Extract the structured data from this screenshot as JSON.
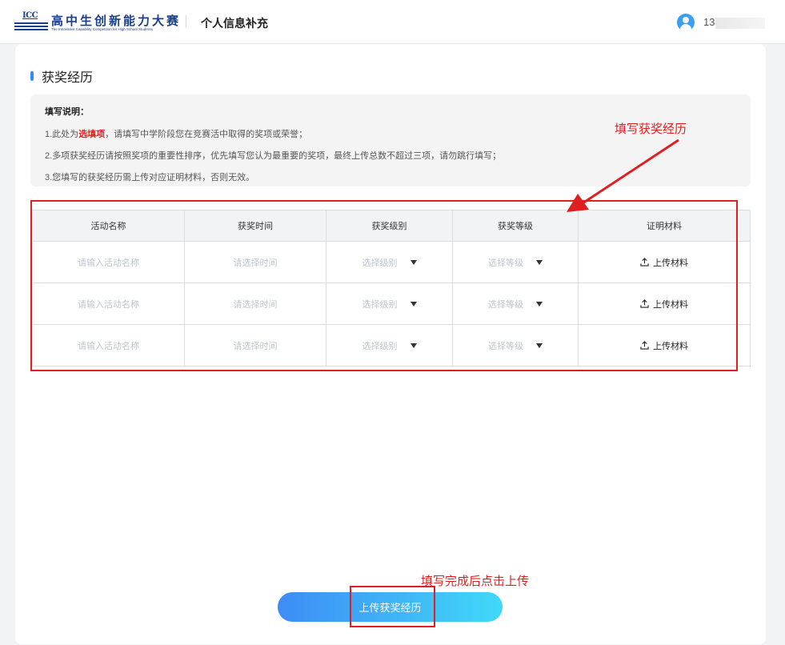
{
  "header": {
    "logo_short": "ICC",
    "logo_cn": "高中生创新能力大赛",
    "logo_en": "The Innovative Capability Competition for High School Students",
    "page_title": "个人信息补充",
    "phone_prefix": "13"
  },
  "section": {
    "title": "获奖经历"
  },
  "notice": {
    "title": "填写说明：",
    "line1_pre": "1.此处为",
    "line1_highlight": "选填项",
    "line1_post": "，请填写中学阶段您在竞赛活中取得的奖项或荣誉；",
    "line2": "2.多项获奖经历请按照奖项的重要性排序，优先填写您认为最重要的奖项，最终上传总数不超过三项，请勿跳行填写；",
    "line3": "3.您填写的获奖经历需上传对应证明材料，否则无效。"
  },
  "table": {
    "headers": [
      "活动名称",
      "获奖时间",
      "获奖级别",
      "获奖等级",
      "证明材料"
    ],
    "rows": [
      {
        "name_placeholder": "请输入活动名称",
        "time_placeholder": "请选择时间",
        "level_placeholder": "选择级别",
        "grade_placeholder": "选择等级",
        "upload_label": "上传材料"
      },
      {
        "name_placeholder": "请输入活动名称",
        "time_placeholder": "请选择时间",
        "level_placeholder": "选择级别",
        "grade_placeholder": "选择等级",
        "upload_label": "上传材料"
      },
      {
        "name_placeholder": "请输入活动名称",
        "time_placeholder": "请选择时间",
        "level_placeholder": "选择级别",
        "grade_placeholder": "选择等级",
        "upload_label": "上传材料"
      }
    ]
  },
  "submit": {
    "label": "上传获奖经历"
  },
  "annotations": {
    "fill_hint": "填写获奖经历",
    "submit_hint": "填写完成后点击上传"
  },
  "colors": {
    "accent": "#2f8ef5",
    "annotation": "#e02020",
    "highlight": "#e02020"
  }
}
